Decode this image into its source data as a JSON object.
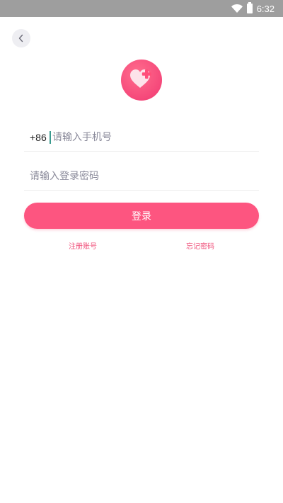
{
  "status_bar": {
    "time": "6:32",
    "wifi_icon": "wifi-icon",
    "battery_icon": "battery-icon",
    "background_color": "#9e9e9e"
  },
  "header": {
    "back_icon": "chevron-left-icon"
  },
  "logo": {
    "icon": "heart-plus-icon",
    "color": "#f5487a"
  },
  "form": {
    "country_code": "+86",
    "phone_placeholder": "请输入手机号",
    "phone_value": "",
    "password_placeholder": "请输入登录密码",
    "password_value": "",
    "login_label": "登录",
    "accent_color": "#fd5580"
  },
  "links": {
    "register": "注册账号",
    "forgot_password": "忘记密码"
  }
}
